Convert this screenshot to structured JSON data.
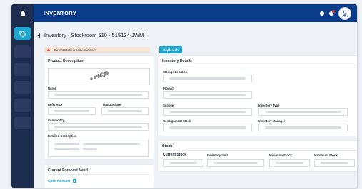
{
  "header": {
    "title": "INVENTORY"
  },
  "page": {
    "title": "Inventory - Stockroom 510 - 515134-JWM"
  },
  "alert": {
    "text": "Current Stock is below minimum"
  },
  "actions": {
    "replenish_label": "Replenish"
  },
  "product_description": {
    "title": "Product Description",
    "name_label": "Name",
    "reference_label": "Reference",
    "manufacturer_label": "Manufacturer",
    "commodity_label": "Commodity",
    "detailed_description_label": "Detailed Description"
  },
  "inventory_details": {
    "title": "Inventory Details",
    "storage_location_label": "Storage Location",
    "product_label": "Product",
    "supplier_label": "Supplier",
    "inventory_type_label": "Inventory Type",
    "consignment_stock_label": "Consignment Stock",
    "inventory_manager_label": "Inventory Manager"
  },
  "stock": {
    "title": "Stock",
    "columns": [
      "Current Stock",
      "Inventory Unit",
      "Minimum Stock",
      "Maximum Stock"
    ]
  },
  "forecast": {
    "title": "Current Forecast Need",
    "link_label": "Open Forecast"
  },
  "colors": {
    "header": "#0b3c8a",
    "sidebar": "#1d2d50",
    "accent": "#1ba6cf",
    "alert_bg": "#f7e3d6",
    "alert_icon": "#e0452d"
  },
  "icons": {
    "home": "home-icon",
    "active_nav": "tag-icon",
    "avatar": "user-icon"
  }
}
